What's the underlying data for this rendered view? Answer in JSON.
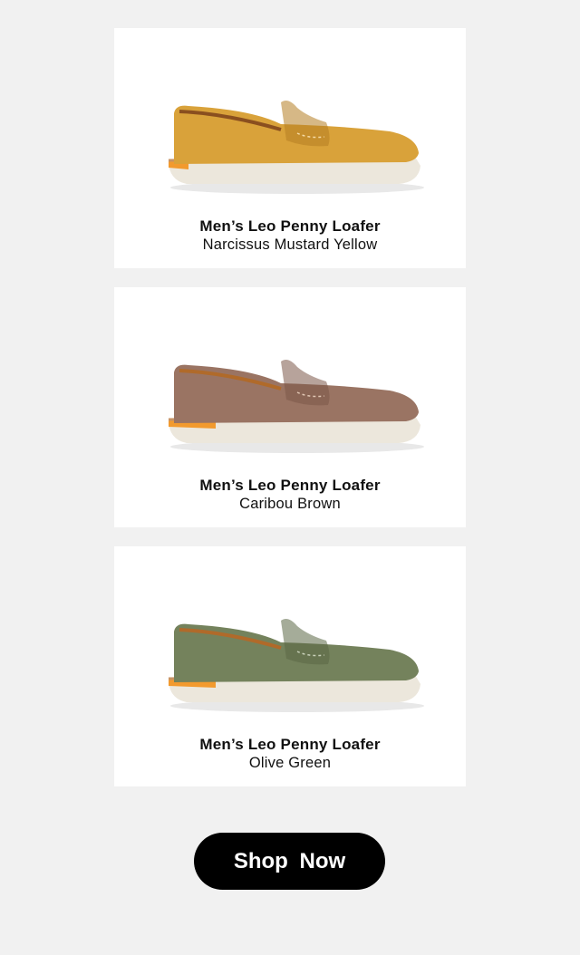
{
  "products": [
    {
      "name": "Men’s Leo Penny Loafer",
      "color_name": "Narcissus Mustard Yellow",
      "shoe_color": "#d9a23a",
      "shoe_shadow": "#b57e22",
      "icon": "penny-loafer-mustard-image"
    },
    {
      "name": "Men’s Leo Penny Loafer",
      "color_name": "Caribou Brown",
      "shoe_color": "#9a7463",
      "shoe_shadow": "#7b5848",
      "icon": "penny-loafer-brown-image"
    },
    {
      "name": "Men’s Leo Penny Loafer",
      "color_name": "Olive Green",
      "shoe_color": "#74825c",
      "shoe_shadow": "#5b6846",
      "icon": "penny-loafer-olive-image"
    }
  ],
  "cta": {
    "label": "Shop Now"
  },
  "colors": {
    "background": "#f1f1f1",
    "card": "#ffffff",
    "sole": "#ece7dc",
    "sole_accent": "#f29a2e",
    "cta_bg": "#000000",
    "cta_text": "#ffffff"
  }
}
